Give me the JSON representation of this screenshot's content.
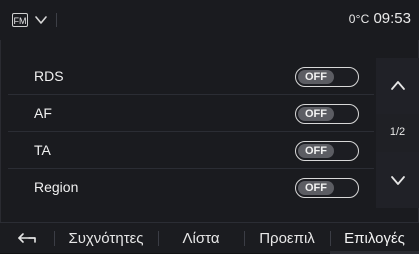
{
  "statusbar": {
    "source_label": "FM",
    "temperature": "0°C",
    "time": "09:53"
  },
  "settings": {
    "items": [
      {
        "label": "RDS",
        "toggle": "OFF"
      },
      {
        "label": "AF",
        "toggle": "OFF"
      },
      {
        "label": "TA",
        "toggle": "OFF"
      },
      {
        "label": "Region",
        "toggle": "OFF"
      }
    ]
  },
  "pager": {
    "page_indicator": "1/2"
  },
  "tabs": [
    {
      "label": "Συχνότητες"
    },
    {
      "label": "Λίστα"
    },
    {
      "label": "Προεπιλ"
    },
    {
      "label": "Επιλογές"
    }
  ],
  "icons": {
    "back": "back-arrow-icon",
    "dropdown": "chevron-down-icon",
    "page_up": "chevron-up-icon",
    "page_down": "chevron-down-icon"
  },
  "colors": {
    "background": "#1a1b1f",
    "toggle_knob": "#5c5d63",
    "text": "#e6e6e6"
  }
}
